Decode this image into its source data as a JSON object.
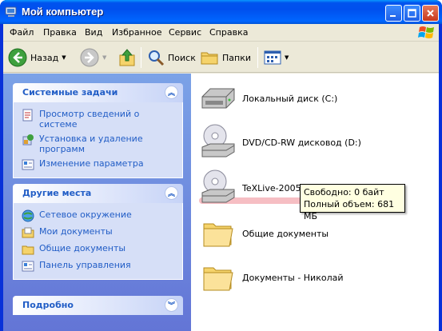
{
  "window": {
    "title": "Мой компьютер"
  },
  "menu": {
    "items": [
      {
        "label": "Файл"
      },
      {
        "label": "Правка"
      },
      {
        "label": "Вид"
      },
      {
        "label": "Избранное"
      },
      {
        "label": "Сервис"
      },
      {
        "label": "Справка"
      }
    ]
  },
  "toolbar": {
    "back_label": "Назад",
    "search_label": "Поиск",
    "folders_label": "Папки"
  },
  "sidebar": {
    "system_tasks": {
      "title": "Системные задачи",
      "items": [
        {
          "label": "Просмотр сведений о системе",
          "icon": "system-info-icon"
        },
        {
          "label": "Установка и удаление программ",
          "icon": "add-remove-programs-icon"
        },
        {
          "label": "Изменение параметра",
          "icon": "control-panel-icon"
        }
      ]
    },
    "other_places": {
      "title": "Другие места",
      "items": [
        {
          "label": "Сетевое окружение",
          "icon": "network-icon"
        },
        {
          "label": "Мои документы",
          "icon": "my-documents-icon"
        },
        {
          "label": "Общие документы",
          "icon": "shared-documents-icon"
        },
        {
          "label": "Панель управления",
          "icon": "control-panel-icon"
        }
      ]
    },
    "details": {
      "title": "Подробно"
    }
  },
  "content": {
    "items": [
      {
        "label": "Локальный диск (C:)",
        "icon": "hard-drive-icon"
      },
      {
        "label": "DVD/CD-RW дисковод (D:)",
        "icon": "cd-drive-icon"
      },
      {
        "label": "TeXLive-2005 (T:)",
        "icon": "cd-drive-icon"
      },
      {
        "label": "Общие документы",
        "icon": "folder-icon"
      },
      {
        "label": "Документы - Николай",
        "icon": "folder-icon"
      }
    ],
    "tooltip": {
      "free": "Свободно: 0 байт",
      "total": "Полный объем: 681 МБ"
    }
  },
  "colors": {
    "title_bar": "#0054e3",
    "task_link": "#215dc6",
    "highlight": "#f4b3b8"
  }
}
